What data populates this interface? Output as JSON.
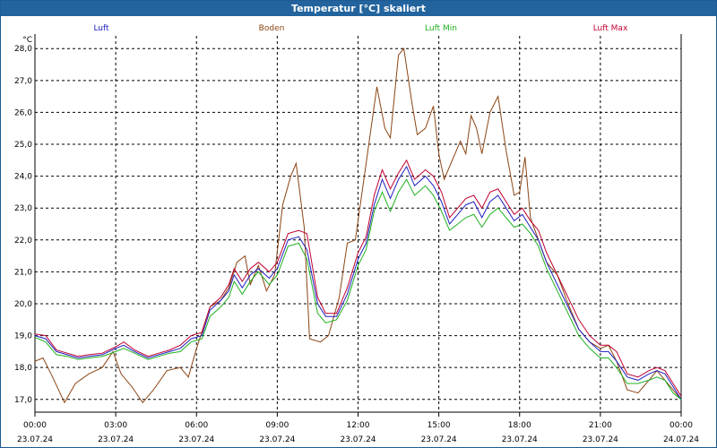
{
  "title": "Temperatur [°C] skaliert",
  "chart_data": {
    "type": "line",
    "title": "Temperatur [°C] skaliert",
    "ylabel": "°C",
    "ylim": [
      16.6,
      28.4
    ],
    "yticks": [
      "17,0",
      "18,0",
      "19,0",
      "20,0",
      "21,0",
      "22,0",
      "23,0",
      "24,0",
      "25,0",
      "26,0",
      "27,0",
      "28,0"
    ],
    "xticks": [
      {
        "time": "00:00",
        "date": "23.07.24"
      },
      {
        "time": "03:00",
        "date": "23.07.24"
      },
      {
        "time": "06:00",
        "date": "23.07.24"
      },
      {
        "time": "09:00",
        "date": "23.07.24"
      },
      {
        "time": "12:00",
        "date": "23.07.24"
      },
      {
        "time": "15:00",
        "date": "23.07.24"
      },
      {
        "time": "18:00",
        "date": "23.07.24"
      },
      {
        "time": "21:00",
        "date": "23.07.24"
      },
      {
        "time": "00:00",
        "date": "24.07.24"
      }
    ],
    "grid": true,
    "legend_position": "top",
    "series": [
      {
        "name": "Boden",
        "color": "#8b4513",
        "points": [
          [
            0,
            18.2
          ],
          [
            0.3,
            18.3
          ],
          [
            0.6,
            17.8
          ],
          [
            1.1,
            16.9
          ],
          [
            1.5,
            17.5
          ],
          [
            2.0,
            17.8
          ],
          [
            2.5,
            18.0
          ],
          [
            2.9,
            18.5
          ],
          [
            3.2,
            17.8
          ],
          [
            3.6,
            17.4
          ],
          [
            4.0,
            16.9
          ],
          [
            4.4,
            17.3
          ],
          [
            4.9,
            17.9
          ],
          [
            5.4,
            18.0
          ],
          [
            5.7,
            17.7
          ],
          [
            6.0,
            18.6
          ],
          [
            6.5,
            19.9
          ],
          [
            6.9,
            20.1
          ],
          [
            7.2,
            20.5
          ],
          [
            7.5,
            21.3
          ],
          [
            7.8,
            21.5
          ],
          [
            8.0,
            20.6
          ],
          [
            8.3,
            21.2
          ],
          [
            8.6,
            20.4
          ],
          [
            8.9,
            20.9
          ],
          [
            9.2,
            23.1
          ],
          [
            9.5,
            24.0
          ],
          [
            9.7,
            24.4
          ],
          [
            10.0,
            22.4
          ],
          [
            10.2,
            18.9
          ],
          [
            10.6,
            18.8
          ],
          [
            10.9,
            19.0
          ],
          [
            11.3,
            20.2
          ],
          [
            11.6,
            21.9
          ],
          [
            11.9,
            22.0
          ],
          [
            12.2,
            23.8
          ],
          [
            12.5,
            25.6
          ],
          [
            12.7,
            26.8
          ],
          [
            13.0,
            25.5
          ],
          [
            13.2,
            25.2
          ],
          [
            13.5,
            27.8
          ],
          [
            13.7,
            28.0
          ],
          [
            14.0,
            26.3
          ],
          [
            14.2,
            25.3
          ],
          [
            14.5,
            25.5
          ],
          [
            14.8,
            26.2
          ],
          [
            15.0,
            24.7
          ],
          [
            15.2,
            23.9
          ],
          [
            15.5,
            24.5
          ],
          [
            15.8,
            25.1
          ],
          [
            16.0,
            24.7
          ],
          [
            16.2,
            25.9
          ],
          [
            16.4,
            25.5
          ],
          [
            16.6,
            24.7
          ],
          [
            16.9,
            26.0
          ],
          [
            17.2,
            26.5
          ],
          [
            17.5,
            24.8
          ],
          [
            17.8,
            23.4
          ],
          [
            18.0,
            23.5
          ],
          [
            18.2,
            24.6
          ],
          [
            18.4,
            22.7
          ],
          [
            18.7,
            22.0
          ],
          [
            19.0,
            21.3
          ],
          [
            19.4,
            20.9
          ],
          [
            19.8,
            20.0
          ],
          [
            20.2,
            19.2
          ],
          [
            20.6,
            18.8
          ],
          [
            21.0,
            18.6
          ],
          [
            21.3,
            18.7
          ],
          [
            21.6,
            18.2
          ],
          [
            22.0,
            17.3
          ],
          [
            22.4,
            17.2
          ],
          [
            22.8,
            17.6
          ],
          [
            23.1,
            17.9
          ],
          [
            23.4,
            17.6
          ],
          [
            23.7,
            17.3
          ],
          [
            24.0,
            17.0
          ]
        ]
      },
      {
        "name": "Luft",
        "color": "#2020c0",
        "points": [
          [
            0,
            19.0
          ],
          [
            0.4,
            18.9
          ],
          [
            0.8,
            18.5
          ],
          [
            1.2,
            18.4
          ],
          [
            1.6,
            18.3
          ],
          [
            2.0,
            18.35
          ],
          [
            2.5,
            18.4
          ],
          [
            3.0,
            18.6
          ],
          [
            3.3,
            18.7
          ],
          [
            3.7,
            18.5
          ],
          [
            4.2,
            18.3
          ],
          [
            4.6,
            18.4
          ],
          [
            5.0,
            18.5
          ],
          [
            5.4,
            18.6
          ],
          [
            5.8,
            18.9
          ],
          [
            6.2,
            19.0
          ],
          [
            6.5,
            19.8
          ],
          [
            6.9,
            20.1
          ],
          [
            7.2,
            20.4
          ],
          [
            7.4,
            20.9
          ],
          [
            7.7,
            20.5
          ],
          [
            8.0,
            20.9
          ],
          [
            8.3,
            21.1
          ],
          [
            8.7,
            20.8
          ],
          [
            9.0,
            21.1
          ],
          [
            9.4,
            22.0
          ],
          [
            9.8,
            22.1
          ],
          [
            10.1,
            21.7
          ],
          [
            10.5,
            20.0
          ],
          [
            10.8,
            19.6
          ],
          [
            11.2,
            19.6
          ],
          [
            11.6,
            20.3
          ],
          [
            12.0,
            21.4
          ],
          [
            12.3,
            21.9
          ],
          [
            12.6,
            23.1
          ],
          [
            12.9,
            23.9
          ],
          [
            13.2,
            23.3
          ],
          [
            13.5,
            23.9
          ],
          [
            13.8,
            24.3
          ],
          [
            14.1,
            23.7
          ],
          [
            14.5,
            24.0
          ],
          [
            14.8,
            23.7
          ],
          [
            15.1,
            23.2
          ],
          [
            15.4,
            22.5
          ],
          [
            15.7,
            22.8
          ],
          [
            16.0,
            23.1
          ],
          [
            16.3,
            23.2
          ],
          [
            16.6,
            22.7
          ],
          [
            16.9,
            23.2
          ],
          [
            17.2,
            23.4
          ],
          [
            17.5,
            23.0
          ],
          [
            17.8,
            22.6
          ],
          [
            18.1,
            22.8
          ],
          [
            18.4,
            22.4
          ],
          [
            18.7,
            22.0
          ],
          [
            19.0,
            21.3
          ],
          [
            19.4,
            20.6
          ],
          [
            19.8,
            19.9
          ],
          [
            20.2,
            19.2
          ],
          [
            20.6,
            18.8
          ],
          [
            21.0,
            18.5
          ],
          [
            21.3,
            18.5
          ],
          [
            21.6,
            18.2
          ],
          [
            22.0,
            17.7
          ],
          [
            22.4,
            17.6
          ],
          [
            22.8,
            17.8
          ],
          [
            23.1,
            17.9
          ],
          [
            23.4,
            17.8
          ],
          [
            23.7,
            17.4
          ],
          [
            24.0,
            17.0
          ]
        ]
      },
      {
        "name": "Luft Min",
        "color": "#20b020",
        "points": [
          [
            0,
            18.95
          ],
          [
            0.4,
            18.8
          ],
          [
            0.8,
            18.4
          ],
          [
            1.2,
            18.35
          ],
          [
            1.6,
            18.25
          ],
          [
            2.0,
            18.3
          ],
          [
            2.5,
            18.35
          ],
          [
            3.0,
            18.5
          ],
          [
            3.3,
            18.6
          ],
          [
            3.7,
            18.45
          ],
          [
            4.2,
            18.25
          ],
          [
            4.6,
            18.35
          ],
          [
            5.0,
            18.45
          ],
          [
            5.4,
            18.5
          ],
          [
            5.8,
            18.8
          ],
          [
            6.2,
            18.9
          ],
          [
            6.5,
            19.6
          ],
          [
            6.9,
            19.9
          ],
          [
            7.2,
            20.2
          ],
          [
            7.4,
            20.7
          ],
          [
            7.7,
            20.3
          ],
          [
            8.0,
            20.7
          ],
          [
            8.3,
            21.0
          ],
          [
            8.7,
            20.6
          ],
          [
            9.0,
            20.9
          ],
          [
            9.4,
            21.8
          ],
          [
            9.8,
            21.9
          ],
          [
            10.1,
            21.4
          ],
          [
            10.5,
            19.7
          ],
          [
            10.8,
            19.4
          ],
          [
            11.2,
            19.5
          ],
          [
            11.6,
            20.1
          ],
          [
            12.0,
            21.2
          ],
          [
            12.3,
            21.7
          ],
          [
            12.6,
            22.9
          ],
          [
            12.9,
            23.5
          ],
          [
            13.2,
            22.9
          ],
          [
            13.5,
            23.5
          ],
          [
            13.8,
            23.9
          ],
          [
            14.1,
            23.4
          ],
          [
            14.5,
            23.7
          ],
          [
            14.8,
            23.4
          ],
          [
            15.1,
            22.9
          ],
          [
            15.4,
            22.3
          ],
          [
            15.7,
            22.5
          ],
          [
            16.0,
            22.7
          ],
          [
            16.3,
            22.8
          ],
          [
            16.6,
            22.4
          ],
          [
            16.9,
            22.8
          ],
          [
            17.2,
            23.0
          ],
          [
            17.5,
            22.7
          ],
          [
            17.8,
            22.4
          ],
          [
            18.1,
            22.5
          ],
          [
            18.4,
            22.2
          ],
          [
            18.7,
            21.8
          ],
          [
            19.0,
            21.1
          ],
          [
            19.4,
            20.4
          ],
          [
            19.8,
            19.7
          ],
          [
            20.2,
            19.0
          ],
          [
            20.6,
            18.6
          ],
          [
            21.0,
            18.3
          ],
          [
            21.3,
            18.3
          ],
          [
            21.6,
            18.0
          ],
          [
            22.0,
            17.5
          ],
          [
            22.4,
            17.5
          ],
          [
            22.8,
            17.6
          ],
          [
            23.1,
            17.7
          ],
          [
            23.4,
            17.6
          ],
          [
            23.7,
            17.2
          ],
          [
            24.0,
            17.0
          ]
        ]
      },
      {
        "name": "Luft Max",
        "color": "#c00030",
        "points": [
          [
            0,
            19.05
          ],
          [
            0.4,
            19.0
          ],
          [
            0.8,
            18.55
          ],
          [
            1.2,
            18.45
          ],
          [
            1.6,
            18.35
          ],
          [
            2.0,
            18.4
          ],
          [
            2.5,
            18.45
          ],
          [
            3.0,
            18.65
          ],
          [
            3.3,
            18.8
          ],
          [
            3.7,
            18.55
          ],
          [
            4.2,
            18.35
          ],
          [
            4.6,
            18.45
          ],
          [
            5.0,
            18.55
          ],
          [
            5.4,
            18.7
          ],
          [
            5.8,
            19.0
          ],
          [
            6.2,
            19.1
          ],
          [
            6.5,
            19.9
          ],
          [
            6.9,
            20.2
          ],
          [
            7.2,
            20.6
          ],
          [
            7.4,
            21.1
          ],
          [
            7.7,
            20.7
          ],
          [
            8.0,
            21.1
          ],
          [
            8.3,
            21.3
          ],
          [
            8.7,
            21.0
          ],
          [
            9.0,
            21.3
          ],
          [
            9.4,
            22.2
          ],
          [
            9.8,
            22.3
          ],
          [
            10.1,
            22.2
          ],
          [
            10.5,
            20.2
          ],
          [
            10.8,
            19.7
          ],
          [
            11.2,
            19.7
          ],
          [
            11.6,
            20.5
          ],
          [
            12.0,
            21.6
          ],
          [
            12.3,
            22.1
          ],
          [
            12.6,
            23.4
          ],
          [
            12.9,
            24.2
          ],
          [
            13.2,
            23.6
          ],
          [
            13.5,
            24.1
          ],
          [
            13.8,
            24.5
          ],
          [
            14.1,
            23.9
          ],
          [
            14.5,
            24.2
          ],
          [
            14.8,
            24.0
          ],
          [
            15.1,
            23.5
          ],
          [
            15.4,
            22.7
          ],
          [
            15.7,
            23.0
          ],
          [
            16.0,
            23.3
          ],
          [
            16.3,
            23.4
          ],
          [
            16.6,
            23.0
          ],
          [
            16.9,
            23.5
          ],
          [
            17.2,
            23.6
          ],
          [
            17.5,
            23.2
          ],
          [
            17.8,
            22.8
          ],
          [
            18.1,
            23.0
          ],
          [
            18.4,
            22.6
          ],
          [
            18.7,
            22.3
          ],
          [
            19.0,
            21.6
          ],
          [
            19.4,
            20.9
          ],
          [
            19.8,
            20.2
          ],
          [
            20.2,
            19.5
          ],
          [
            20.6,
            19.0
          ],
          [
            21.0,
            18.7
          ],
          [
            21.3,
            18.7
          ],
          [
            21.6,
            18.5
          ],
          [
            22.0,
            17.8
          ],
          [
            22.4,
            17.7
          ],
          [
            22.8,
            17.9
          ],
          [
            23.1,
            18.0
          ],
          [
            23.4,
            17.9
          ],
          [
            23.7,
            17.5
          ],
          [
            24.0,
            17.1
          ]
        ]
      }
    ]
  }
}
